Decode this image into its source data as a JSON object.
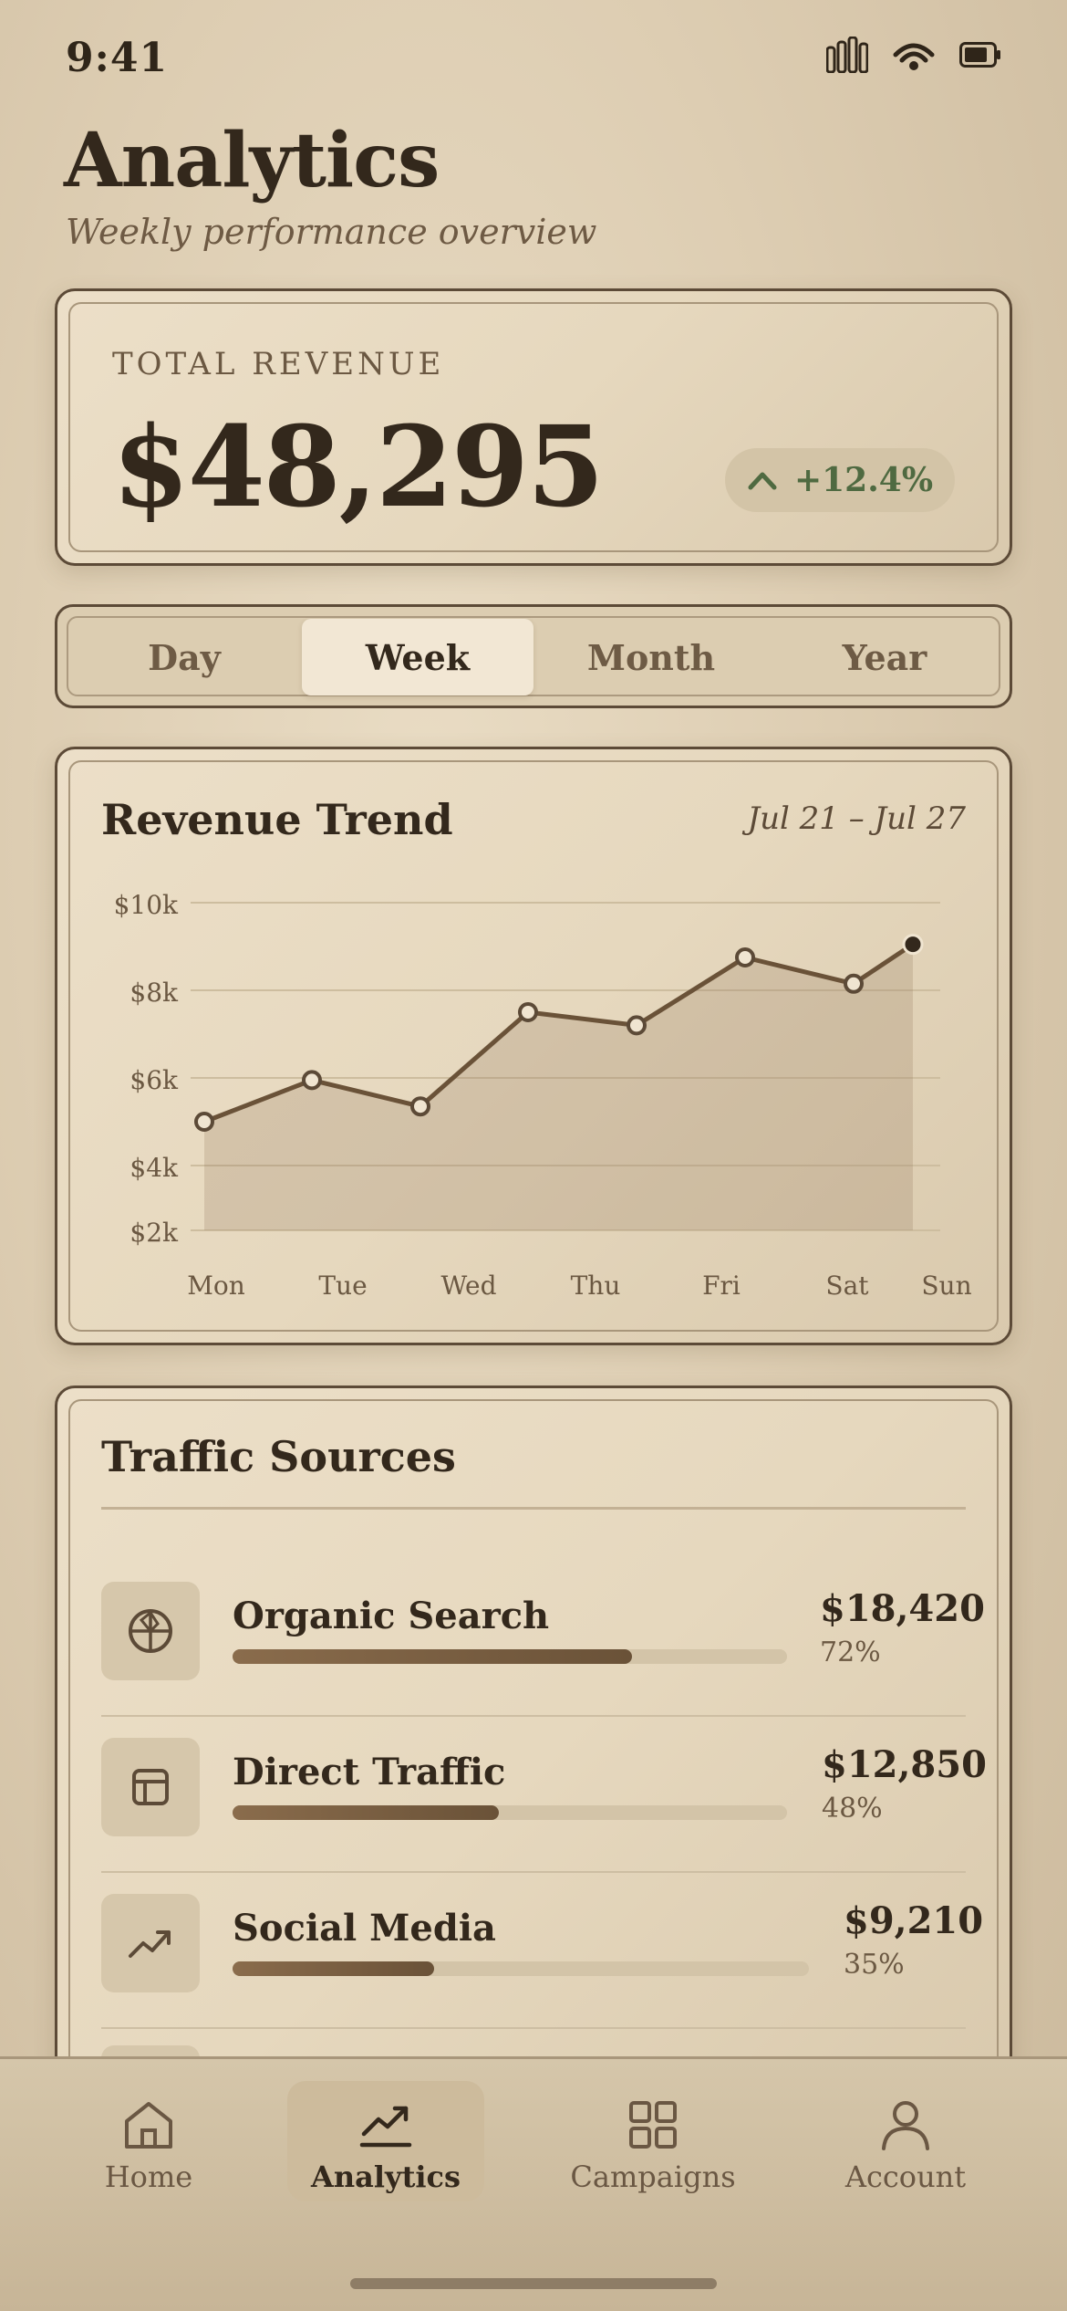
{
  "status": {
    "time": "9:41"
  },
  "header": {
    "title": "Analytics",
    "subtitle": "Weekly performance overview"
  },
  "revenue": {
    "label": "TOTAL REVENUE",
    "value": "$48,295",
    "change": "+12.4%"
  },
  "period_tabs": [
    {
      "label": "Day",
      "active": false
    },
    {
      "label": "Week",
      "active": true
    },
    {
      "label": "Month",
      "active": false
    },
    {
      "label": "Year",
      "active": false
    }
  ],
  "chart": {
    "title": "Revenue Trend",
    "range": "Jul 21 – Jul 27"
  },
  "chart_data": {
    "type": "area",
    "categories": [
      "Mon",
      "Tue",
      "Wed",
      "Thu",
      "Fri",
      "Sat",
      "Sun"
    ],
    "values": [
      5000,
      5950,
      5350,
      7500,
      7200,
      8750,
      8150,
      9050
    ],
    "x_values": [
      "Mon",
      "Tue",
      "Wed",
      "Thu",
      "Fri",
      "Sat",
      "Sun"
    ],
    "ytick_labels": [
      "$10k",
      "$8k",
      "$6k",
      "$4k",
      "$2k"
    ],
    "grid": true
  },
  "traffic": {
    "title": "Traffic Sources",
    "sources": [
      {
        "name": "Organic Search",
        "amount": "$18,420",
        "pct": "72%",
        "fraction": 0.72,
        "icon": "globe-icon"
      },
      {
        "name": "Direct Traffic",
        "amount": "$12,850",
        "pct": "48%",
        "fraction": 0.48,
        "icon": "layout-icon"
      },
      {
        "name": "Social Media",
        "amount": "$9,210",
        "pct": "35%",
        "fraction": 0.35,
        "icon": "trending-up-icon"
      }
    ]
  },
  "tabbar": [
    {
      "label": "Home",
      "icon": "home-icon",
      "active": false
    },
    {
      "label": "Analytics",
      "icon": "analytics-icon",
      "active": true
    },
    {
      "label": "Campaigns",
      "icon": "grid-icon",
      "active": false
    },
    {
      "label": "Account",
      "icon": "user-icon",
      "active": false
    }
  ],
  "colors": {
    "accent": "#6a5238",
    "positive": "#4f6a41",
    "ink": "#33281c"
  }
}
